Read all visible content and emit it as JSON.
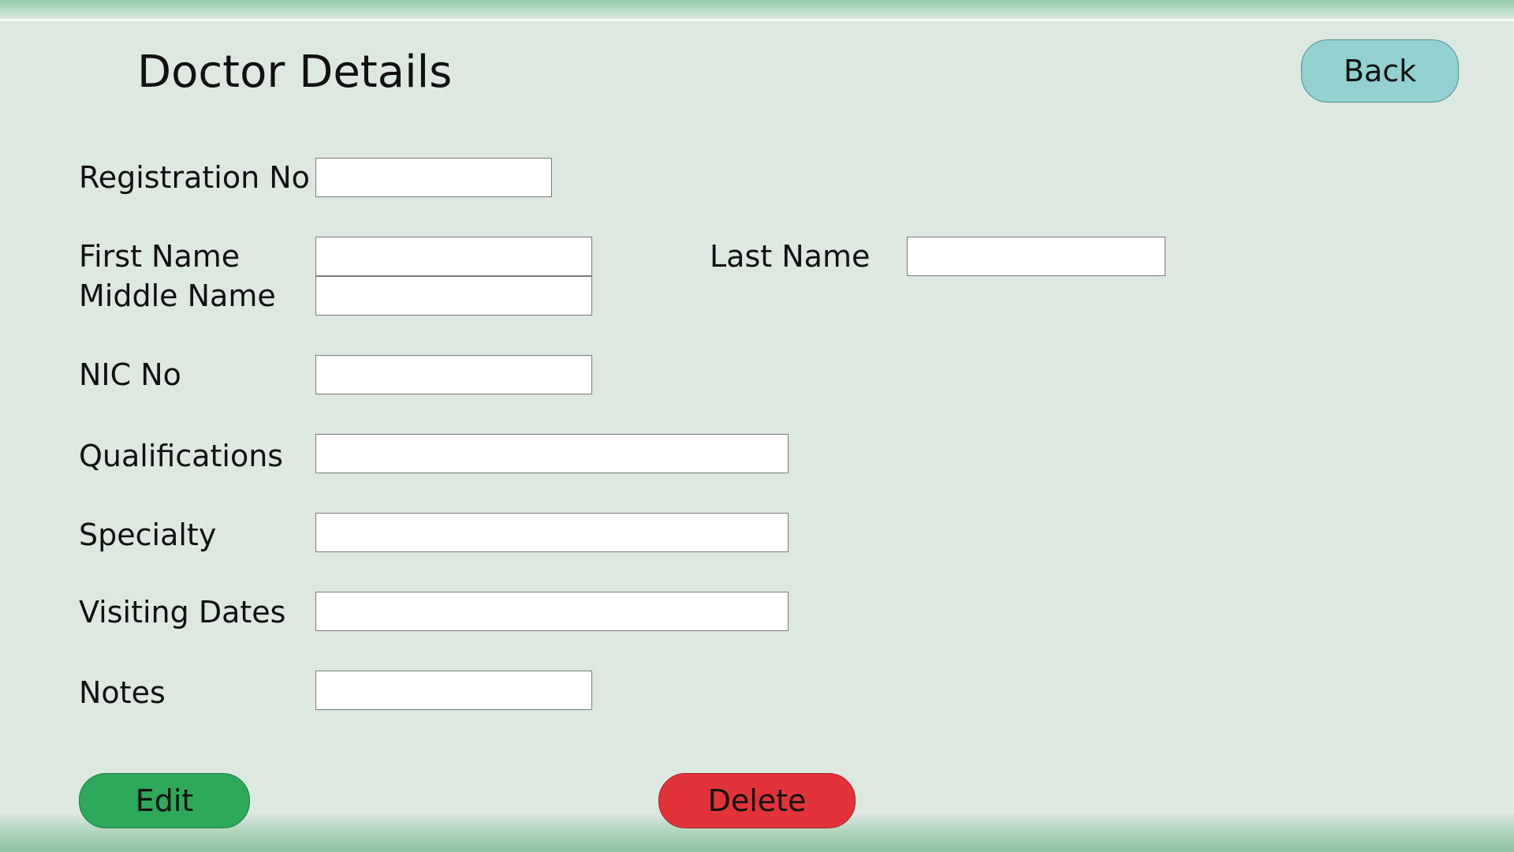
{
  "page": {
    "title": "Doctor Details"
  },
  "buttons": {
    "back": "Back",
    "edit": "Edit",
    "delete": "Delete"
  },
  "form": {
    "registration_no": {
      "label": "Registration No",
      "value": ""
    },
    "first_name": {
      "label": "First Name",
      "value": ""
    },
    "middle_name": {
      "label": "Middle Name",
      "value": ""
    },
    "last_name": {
      "label": "Last Name",
      "value": ""
    },
    "nic_no": {
      "label": "NIC No",
      "value": ""
    },
    "qualifications": {
      "label": "Qualifications",
      "value": ""
    },
    "specialty": {
      "label": "Specialty",
      "value": ""
    },
    "visiting_dates": {
      "label": "Visiting Dates",
      "value": ""
    },
    "notes": {
      "label": "Notes",
      "value": ""
    }
  },
  "colors": {
    "background": "#dde8e1",
    "back_button": "#93d1d1",
    "edit_button": "#2ea85a",
    "delete_button": "#e3333a"
  }
}
